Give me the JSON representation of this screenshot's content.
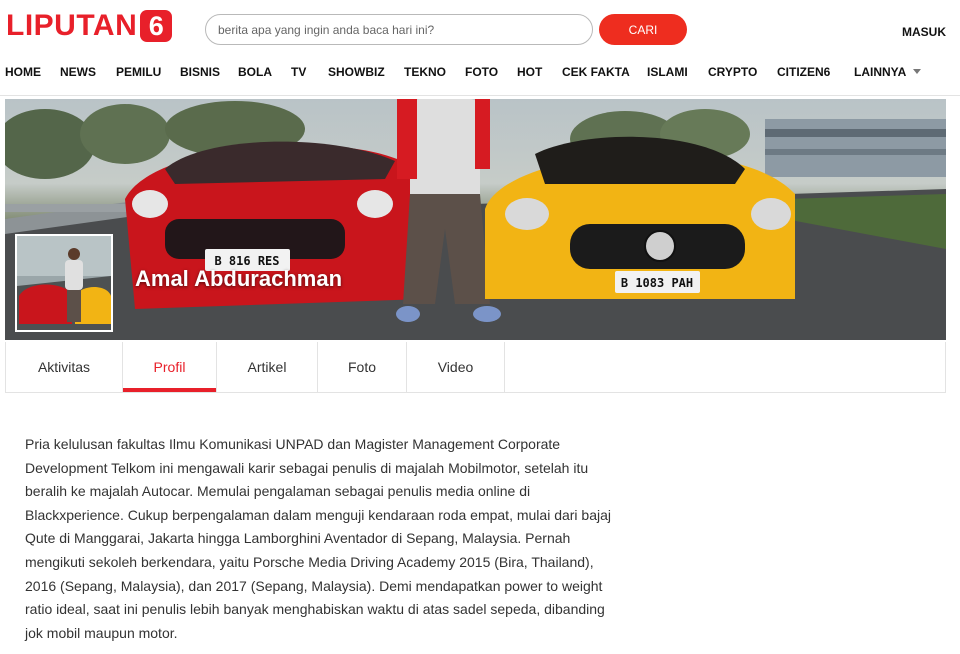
{
  "brand": {
    "logo_text": "LIPUTAN",
    "logo_number": "6",
    "accent_color": "#e8202a"
  },
  "search": {
    "placeholder": "berita apa yang ingin anda baca hari ini?",
    "button_label": "CARI"
  },
  "header": {
    "login_label": "MASUK"
  },
  "nav": {
    "items": [
      "HOME",
      "NEWS",
      "PEMILU",
      "BISNIS",
      "BOLA",
      "TV",
      "SHOWBIZ",
      "TEKNO",
      "FOTO",
      "HOT",
      "CEK FAKTA",
      "ISLAMI",
      "CRYPTO",
      "CITIZEN6",
      "LAINNYA"
    ]
  },
  "profile": {
    "name": "Amal Abdurachman",
    "cover_plates": [
      "B 816 RES",
      "B 1083 PAH"
    ]
  },
  "tabs": {
    "items": [
      "Aktivitas",
      "Profil",
      "Artikel",
      "Foto",
      "Video"
    ],
    "active": "Profil"
  },
  "bio": {
    "text": "Pria kelulusan fakultas Ilmu Komunikasi UNPAD dan Magister Management Corporate Development Telkom ini mengawali karir sebagai penulis di majalah Mobilmotor, setelah itu beralih ke majalah Autocar. Memulai pengalaman sebagai penulis media online di Blackxperience. Cukup berpengalaman dalam menguji kendaraan roda empat, mulai dari bajaj Qute di Manggarai, Jakarta hingga Lamborghini Aventador di Sepang, Malaysia. Pernah mengikuti sekoleh berkendara, yaitu Porsche Media Driving Academy 2015 (Bira, Thailand), 2016 (Sepang, Malaysia), dan 2017 (Sepang, Malaysia). Demi mendapatkan power to weight ratio ideal, saat ini penulis lebih banyak menghabiskan waktu di atas sadel sepeda, dibanding jok mobil maupun motor."
  }
}
